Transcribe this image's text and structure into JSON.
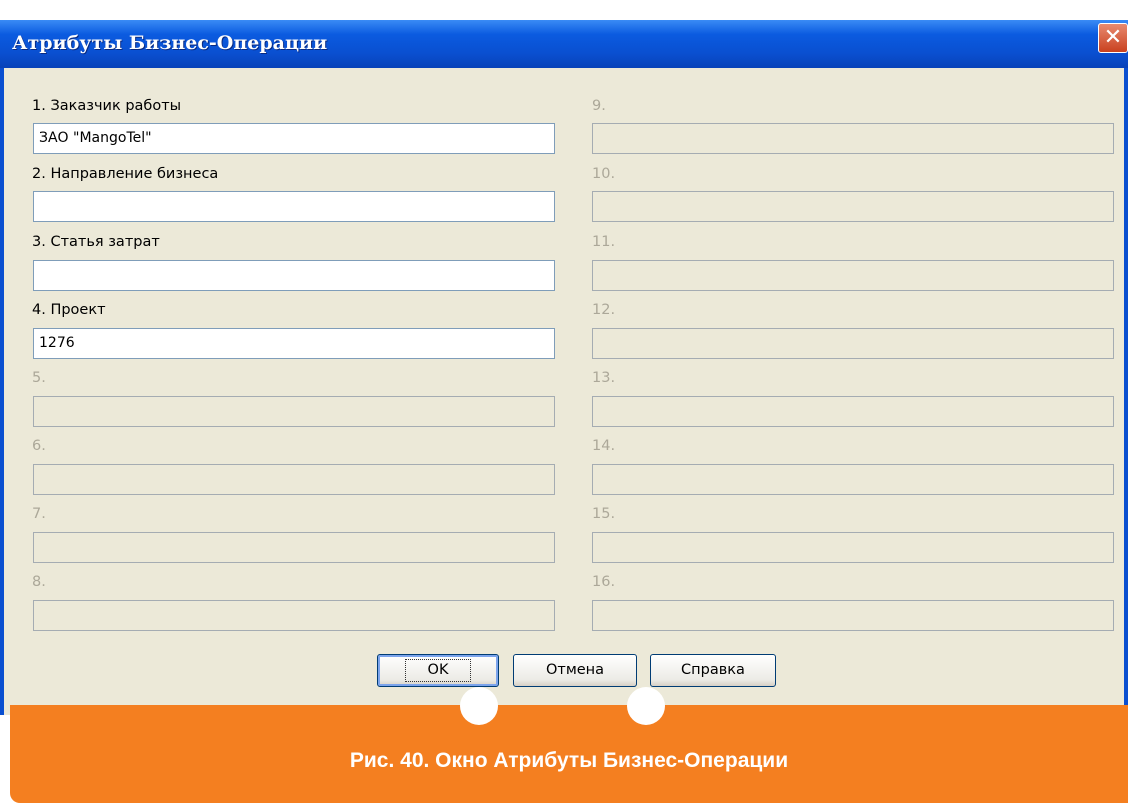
{
  "dialog": {
    "title": "Атрибуты Бизнес-Операции",
    "close_symbol": "✕"
  },
  "left_fields": [
    {
      "label": "1.  Заказчик работы",
      "value": "ЗАО \"MangoTel\"",
      "enabled": true
    },
    {
      "label": "2.  Направление бизнеса",
      "value": "",
      "enabled": true
    },
    {
      "label": "3.  Статья затрат",
      "value": "",
      "enabled": true
    },
    {
      "label": "4.  Проект",
      "value": "1276",
      "enabled": true
    },
    {
      "label": "5.",
      "value": "",
      "enabled": false
    },
    {
      "label": "6.",
      "value": "",
      "enabled": false
    },
    {
      "label": "7.",
      "value": "",
      "enabled": false
    },
    {
      "label": "8.",
      "value": "",
      "enabled": false
    }
  ],
  "right_fields": [
    {
      "label": "9.",
      "value": "",
      "enabled": false
    },
    {
      "label": "10.",
      "value": "",
      "enabled": false
    },
    {
      "label": "11.",
      "value": "",
      "enabled": false
    },
    {
      "label": "12.",
      "value": "",
      "enabled": false
    },
    {
      "label": "13.",
      "value": "",
      "enabled": false
    },
    {
      "label": "14.",
      "value": "",
      "enabled": false
    },
    {
      "label": "15.",
      "value": "",
      "enabled": false
    },
    {
      "label": "16.",
      "value": "",
      "enabled": false
    }
  ],
  "buttons": {
    "ok": "OK",
    "cancel": "Отмена",
    "help": "Справка"
  },
  "caption": "Рис. 40. Окно Атрибуты Бизнес-Операции",
  "colors": {
    "titlebar": "#0A4FD0",
    "dialog_bg": "#ECE9D8",
    "caption_bg": "#F47F20",
    "disabled_text": "#ACA899"
  }
}
